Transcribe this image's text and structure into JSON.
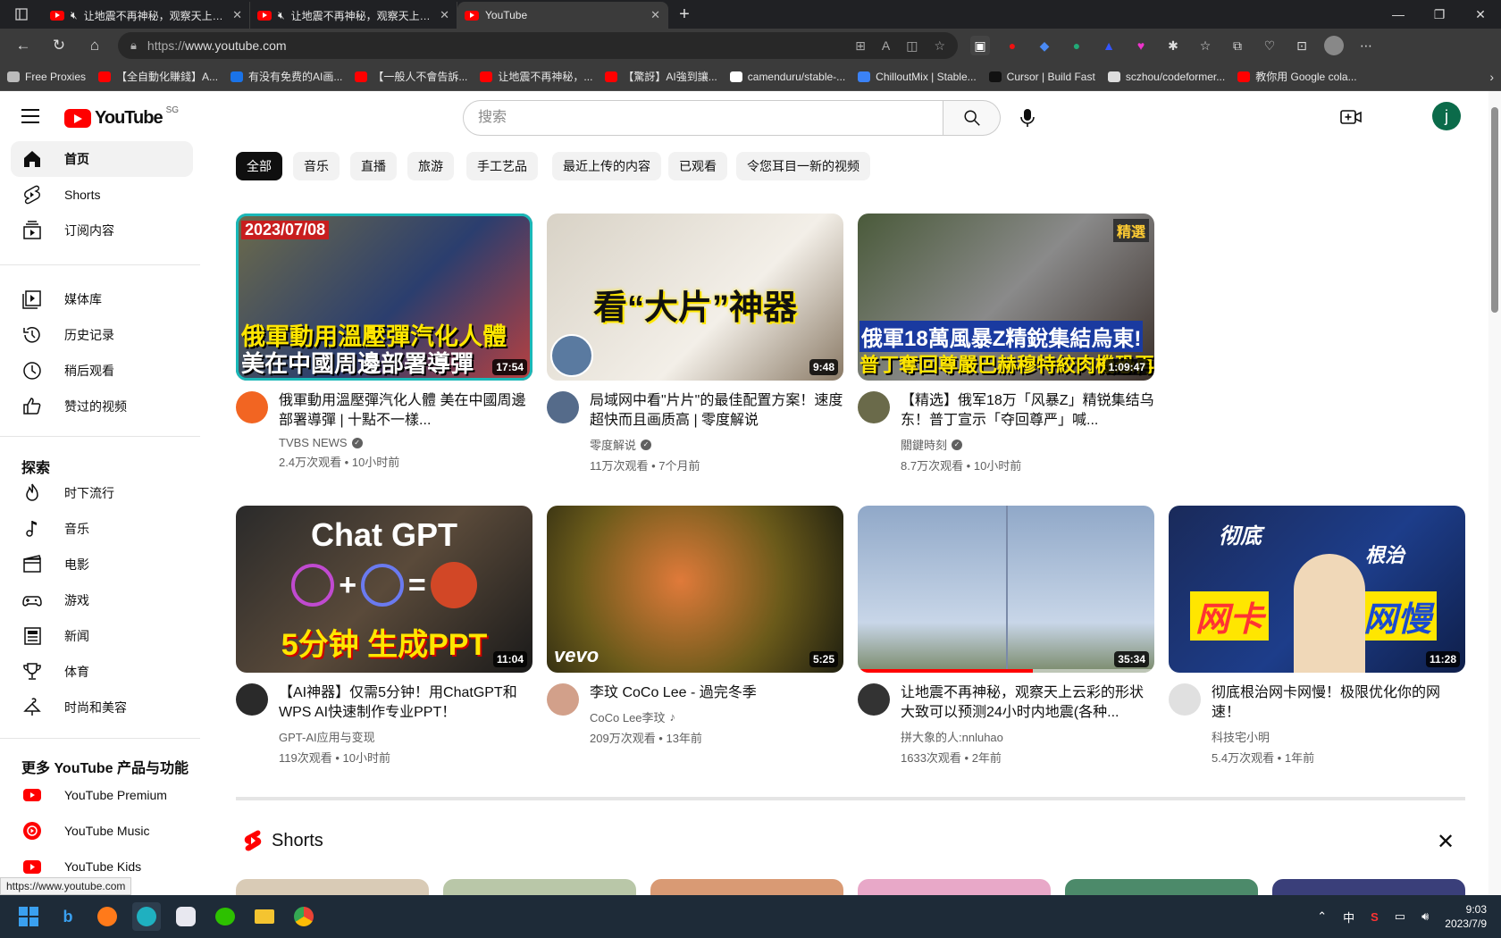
{
  "browser": {
    "tabs": [
      {
        "title": "让地震不再神秘，观察天上云彩",
        "muted": true
      },
      {
        "title": "让地震不再神秘，观察天上云彩",
        "muted": true
      },
      {
        "title": "YouTube",
        "active": true
      }
    ],
    "url_scheme": "https://",
    "url_host": "www.youtube.com",
    "bookmarks": [
      {
        "label": "Free Proxies",
        "icon": "document-icon",
        "color": "#bbbbbb"
      },
      {
        "label": "【全自動化賺錢】A...",
        "icon": "youtube-icon",
        "color": "#ff0000"
      },
      {
        "label": "有没有免费的AI画...",
        "icon": "zhihu-icon",
        "color": "#1a73e8"
      },
      {
        "label": "【一般人不會告訴...",
        "icon": "youtube-icon",
        "color": "#ff0000"
      },
      {
        "label": "让地震不再神秘，...",
        "icon": "youtube-icon",
        "color": "#ff0000"
      },
      {
        "label": "【驚訝】AI強到讓...",
        "icon": "youtube-icon",
        "color": "#ff0000"
      },
      {
        "label": "camenduru/stable-...",
        "icon": "github-icon",
        "color": "#ffffff"
      },
      {
        "label": "ChilloutMix | Stable...",
        "icon": "civitai-icon",
        "color": "#3b82f6"
      },
      {
        "label": "Cursor | Build Fast",
        "icon": "cursor-icon",
        "color": "#111111"
      },
      {
        "label": "sczhou/codeformer...",
        "icon": "replicate-icon",
        "color": "#dddddd"
      },
      {
        "label": "教你用 Google cola...",
        "icon": "youtube-icon",
        "color": "#ff0000"
      }
    ]
  },
  "youtube": {
    "logo_text": "YouTube",
    "region": "SG",
    "search_placeholder": "搜索",
    "avatar_letter": "j",
    "sidebar": {
      "main": [
        {
          "label": "首页",
          "icon": "home-icon",
          "active": true
        },
        {
          "label": "Shorts",
          "icon": "shorts-icon"
        },
        {
          "label": "订阅内容",
          "icon": "subscriptions-icon"
        }
      ],
      "library": [
        {
          "label": "媒体库",
          "icon": "library-icon"
        },
        {
          "label": "历史记录",
          "icon": "history-icon"
        },
        {
          "label": "稍后观看",
          "icon": "watch-later-icon"
        },
        {
          "label": "赞过的视频",
          "icon": "like-icon"
        }
      ],
      "explore_title": "探索",
      "explore": [
        {
          "label": "时下流行",
          "icon": "trending-icon"
        },
        {
          "label": "音乐",
          "icon": "music-icon"
        },
        {
          "label": "电影",
          "icon": "movies-icon"
        },
        {
          "label": "游戏",
          "icon": "gaming-icon"
        },
        {
          "label": "新闻",
          "icon": "news-icon"
        },
        {
          "label": "体育",
          "icon": "sports-icon"
        },
        {
          "label": "时尚和美容",
          "icon": "fashion-icon"
        }
      ],
      "more_title": "更多 YouTube 产品与功能",
      "more": [
        {
          "label": "YouTube Premium",
          "icon": "youtube-premium-icon"
        },
        {
          "label": "YouTube Music",
          "icon": "youtube-music-icon"
        },
        {
          "label": "YouTube Kids",
          "icon": "youtube-kids-icon"
        }
      ]
    },
    "chips": [
      "全部",
      "音乐",
      "直播",
      "旅游",
      "手工艺品",
      "最近上传的内容",
      "已观看",
      "令您耳目一新的视频"
    ],
    "videos": [
      {
        "title": "俄軍動用溫壓彈汽化人體 美在中國周邊部署導彈 | 十點不一樣...",
        "channel": "TVBS NEWS",
        "verified": true,
        "stats": "2.4万次观看 • 10小时前",
        "duration": "17:54",
        "thumb_date": "2023/07/08",
        "thumb_line1": "俄軍動用溫壓彈汽化人體",
        "thumb_line2": "美在中國周邊部署導彈"
      },
      {
        "title": "局域网中看\"片片\"的最佳配置方案！速度超快而且画质高 | 零度解说",
        "channel": "零度解说",
        "verified": true,
        "stats": "11万次观看 • 7个月前",
        "duration": "9:48",
        "thumb_line1": "看“大片”神器"
      },
      {
        "title": "【精选】俄军18万「风暴Z」精锐集结乌东！普丁宣示「夺回尊严」喊...",
        "channel": "關鍵時刻",
        "verified": true,
        "stats": "8.7万次观看 • 10小时前",
        "duration": "1:09:47",
        "thumb_line1": "俄軍18萬風暴Z精銳集結烏東!",
        "thumb_line2": "普丁奪回尊嚴巴赫穆特絞肉機恐再現?",
        "thumb_badge": "精選"
      },
      {
        "title": "【AI神器】仅需5分钟！用ChatGPT和WPS AI快速制作专业PPT！",
        "channel": "GPT-AI应用与变现",
        "verified": false,
        "stats": "119次观看 • 10小时前",
        "duration": "11:04",
        "thumb_line1": "Chat GPT",
        "thumb_line2": "5分钟 生成PPT"
      },
      {
        "title": "李玟 CoCo Lee - 過完冬季",
        "channel": "CoCo Lee李玟",
        "verified": false,
        "music_note": true,
        "stats": "209万次观看 • 13年前",
        "duration": "5:25",
        "thumb_line1": "vevo"
      },
      {
        "title": "让地震不再神秘，观察天上云彩的形状大致可以预测24小时内地震(各种...",
        "channel": "拼大象的人:nnluhao",
        "verified": false,
        "stats": "1633次观看 • 2年前",
        "duration": "35:34",
        "progress": 0.59
      },
      {
        "title": "彻底根治网卡网慢！极限优化你的网速！",
        "channel": "科技宅小明",
        "verified": false,
        "stats": "5.4万次观看 • 1年前",
        "duration": "11:28",
        "thumb_line1": "彻底",
        "thumb_line2": "根治",
        "thumb_line3": "网卡",
        "thumb_line4": "网慢"
      }
    ],
    "shorts_title": "Shorts",
    "status_url": "https://www.youtube.com"
  },
  "taskbar": {
    "ime": "中",
    "time": "9:03",
    "date": "2023/7/9"
  }
}
